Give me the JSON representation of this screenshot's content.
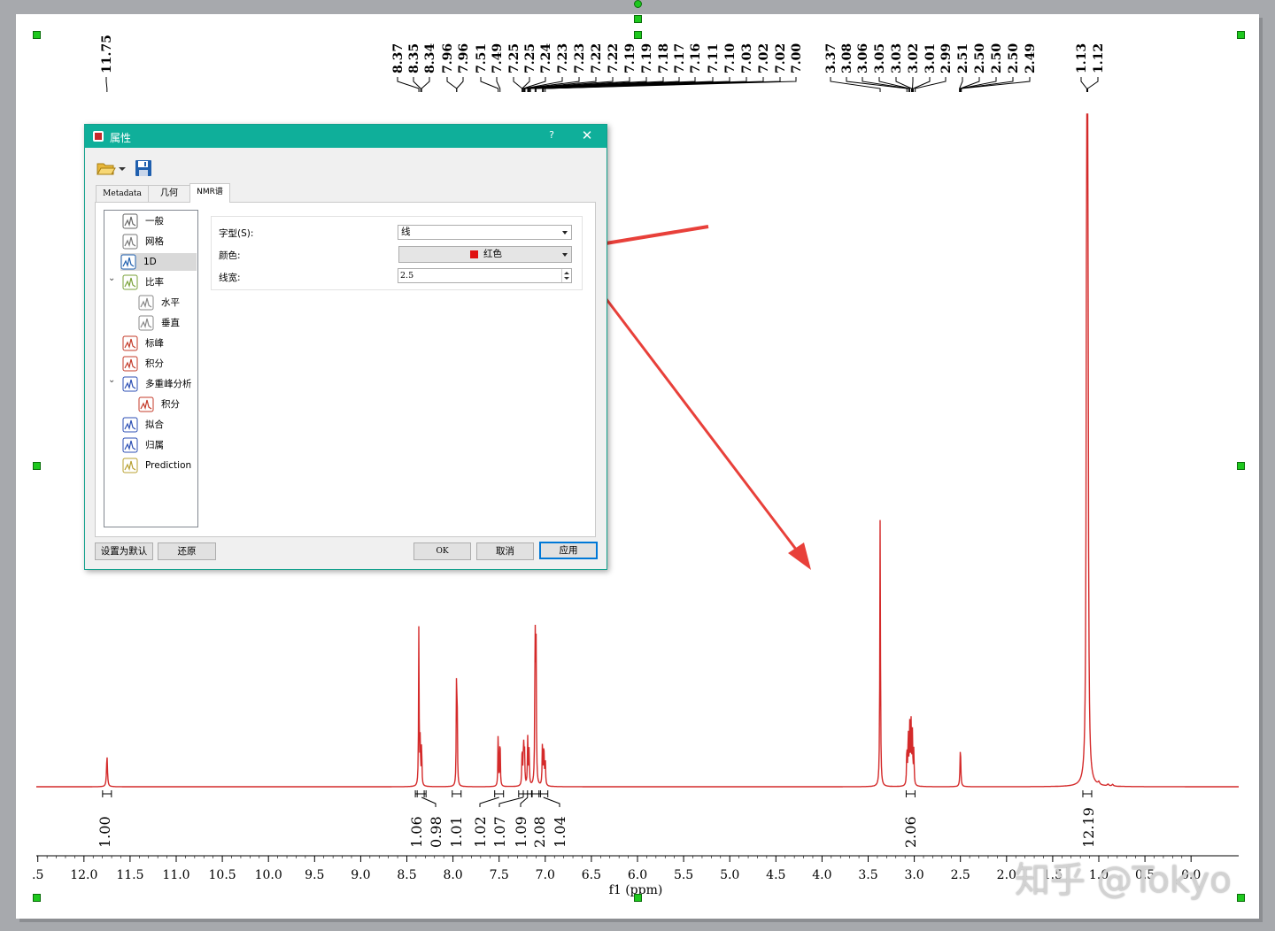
{
  "spectrum": {
    "line_color": "#d42a2a",
    "xaxis": {
      "label": "f1 (ppm)",
      "ticks": [
        ".5",
        "12.0",
        "11.5",
        "11.0",
        "10.5",
        "10.0",
        "9.5",
        "9.0",
        "8.5",
        "8.0",
        "7.5",
        "7.0",
        "6.5",
        "6.0",
        "5.5",
        "5.0",
        "4.5",
        "4.0",
        "3.5",
        "3.0",
        "2.5",
        "2.0",
        "1.5",
        "1.0",
        "0.5",
        "0.0"
      ]
    },
    "peak_labels": [
      "11.75",
      "8.37",
      "8.35",
      "8.34",
      "7.96",
      "7.96",
      "7.51",
      "7.49",
      "7.25",
      "7.25",
      "7.24",
      "7.23",
      "7.23",
      "7.22",
      "7.22",
      "7.19",
      "7.19",
      "7.18",
      "7.17",
      "7.16",
      "7.11",
      "7.10",
      "7.03",
      "7.02",
      "7.02",
      "7.00",
      "3.37",
      "3.08",
      "3.06",
      "3.05",
      "3.03",
      "3.02",
      "3.01",
      "2.99",
      "2.51",
      "2.50",
      "2.50",
      "2.50",
      "2.49",
      "1.13",
      "1.12"
    ],
    "integrals": [
      "1.00",
      "1.06",
      "0.98",
      "1.01",
      "1.02",
      "1.07",
      "1.09",
      "2.08",
      "1.04",
      "2.06",
      "12.19"
    ],
    "watermark": "知乎 @Tokyo"
  },
  "dialog": {
    "title": "属性",
    "help": "?",
    "close": "✕",
    "toolbar": {
      "open_icon": "folder-open-icon",
      "save_icon": "floppy-save-icon"
    },
    "tabs": [
      "Metadata",
      "几何",
      "NMR谱"
    ],
    "tree": [
      {
        "label": "一般",
        "icon": "title-icon"
      },
      {
        "label": "网格",
        "icon": "grid-icon"
      },
      {
        "label": "1D",
        "icon": "spectrum-1d-icon"
      },
      {
        "label": "比率",
        "icon": "ratio-icon"
      },
      {
        "label": "水平",
        "icon": "horizontal-ruler-icon"
      },
      {
        "label": "垂直",
        "icon": "vertical-ruler-icon"
      },
      {
        "label": "标峰",
        "icon": "peak-pick-icon"
      },
      {
        "label": "积分",
        "icon": "integral-icon"
      },
      {
        "label": "多重峰分析",
        "icon": "multiplet-icon"
      },
      {
        "label": "积分",
        "icon": "integral-icon"
      },
      {
        "label": "拟合",
        "icon": "fit-icon"
      },
      {
        "label": "归属",
        "icon": "assign-icon"
      },
      {
        "label": "Prediction",
        "icon": "prediction-icon"
      }
    ],
    "props": {
      "style_label": "字型(S):",
      "style_value": "线",
      "color_label": "颜色:",
      "color_value": "红色",
      "color_swatch": "#e01010",
      "width_label": "线宽:",
      "width_value": "2.5"
    },
    "buttons": {
      "set_default": "设置为默认",
      "restore": "还原",
      "ok": "OK",
      "cancel": "取消",
      "apply": "应用"
    }
  },
  "annotation_color": "#e8403a"
}
